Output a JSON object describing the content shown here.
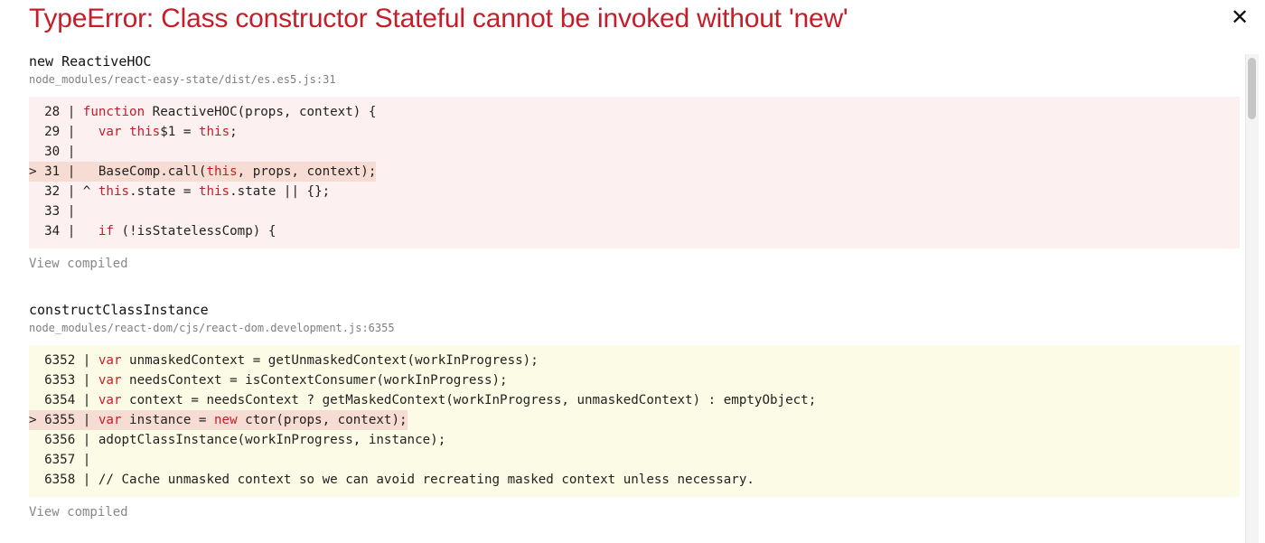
{
  "error": {
    "title": "TypeError: Class constructor Stateful cannot be invoked without 'new'",
    "close_icon": "close-icon"
  },
  "frames": [
    {
      "function": "new ReactiveHOC",
      "file": "node_modules/react-easy-state/dist/es.es5.js:31",
      "theme": "red",
      "lines": [
        {
          "prefix": "  28 | ",
          "code": "function ReactiveHOC(props, context) {",
          "highlighted": false
        },
        {
          "prefix": "  29 | ",
          "code": "  var this$1 = this;",
          "highlighted": false
        },
        {
          "prefix": "  30 | ",
          "code": "",
          "highlighted": false
        },
        {
          "prefix": "> 31 | ",
          "code": "  BaseComp.call(this, props, context);",
          "highlighted": true
        },
        {
          "prefix": "  32 | ",
          "code": "^ this.state = this.state || {};",
          "highlighted": false
        },
        {
          "prefix": "  33 | ",
          "code": "",
          "highlighted": false
        },
        {
          "prefix": "  34 | ",
          "code": "  if (!isStatelessComp) {",
          "highlighted": false
        }
      ],
      "view_compiled": "View compiled"
    },
    {
      "function": "constructClassInstance",
      "file": "node_modules/react-dom/cjs/react-dom.development.js:6355",
      "theme": "yellow",
      "lines": [
        {
          "prefix": "  6352 | ",
          "code": "var unmaskedContext = getUnmaskedContext(workInProgress);",
          "highlighted": false
        },
        {
          "prefix": "  6353 | ",
          "code": "var needsContext = isContextConsumer(workInProgress);",
          "highlighted": false
        },
        {
          "prefix": "  6354 | ",
          "code": "var context = needsContext ? getMaskedContext(workInProgress, unmaskedContext) : emptyObject;",
          "highlighted": false
        },
        {
          "prefix": "> 6355 | ",
          "code": "var instance = new ctor(props, context);",
          "highlighted": true
        },
        {
          "prefix": "  6356 | ",
          "code": "adoptClassInstance(workInProgress, instance);",
          "highlighted": false
        },
        {
          "prefix": "  6357 | ",
          "code": "",
          "highlighted": false
        },
        {
          "prefix": "  6358 | ",
          "code": "// Cache unmasked context so we can avoid recreating masked context unless necessary.",
          "highlighted": false
        }
      ],
      "view_compiled": "View compiled"
    }
  ],
  "colors": {
    "title": "#c41e2a",
    "keyword": "#c41e2a",
    "red_block_bg": "#fcf0f0",
    "yellow_block_bg": "#fcfbe5",
    "highlight_bg": "#f6dcd2",
    "muted_text": "#888888"
  }
}
